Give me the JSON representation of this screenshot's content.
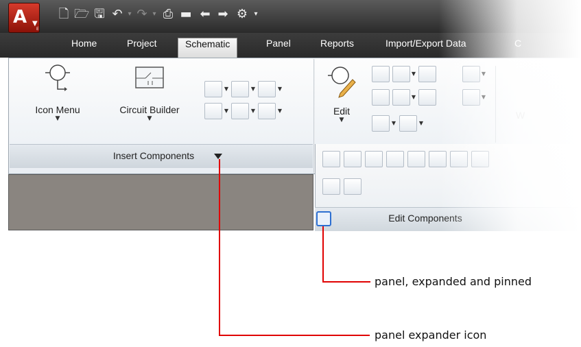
{
  "qat": {
    "icons": [
      "new-file-icon",
      "open-folder-icon",
      "save-icon",
      "undo-icon",
      "redo-icon",
      "print-icon",
      "folder-icon",
      "back-arrow-icon",
      "forward-arrow-icon",
      "project-icon",
      "qat-dropdown-icon"
    ]
  },
  "tabs": [
    {
      "label": "Home"
    },
    {
      "label": "Project"
    },
    {
      "label": "Schematic",
      "active": true
    },
    {
      "label": "Panel"
    },
    {
      "label": "Reports"
    },
    {
      "label": "Import/Export Data"
    },
    {
      "label": "C"
    }
  ],
  "insert_panel": {
    "icon_menu_label": "Icon Menu",
    "circuit_builder_label": "Circuit Builder",
    "title": "Insert Components"
  },
  "edit_panel": {
    "edit_label": "Edit",
    "partial_label": "W",
    "title": "Edit Components"
  },
  "callouts": {
    "expanded_pinned": "panel, expanded and pinned",
    "expander_icon": "panel expander icon"
  },
  "colors": {
    "callout": "#e00000",
    "accent": "#2d6fd1",
    "app_button": "#c42b1c"
  }
}
